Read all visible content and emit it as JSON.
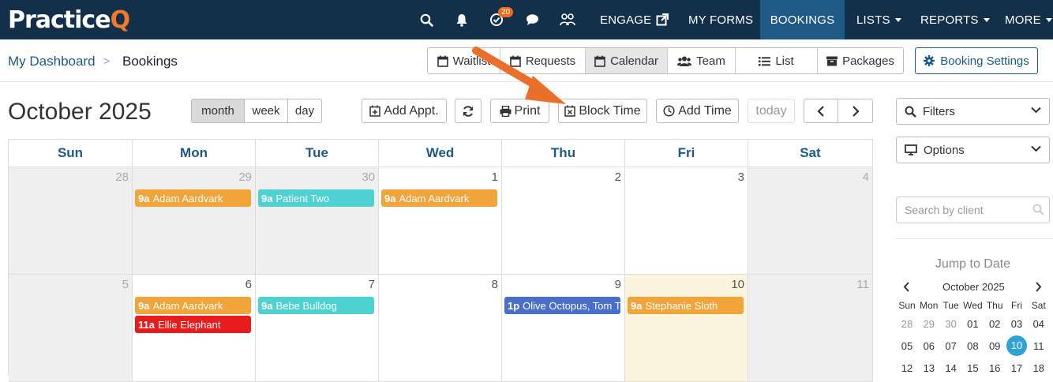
{
  "app": {
    "logo_main": "Practice",
    "logo_accent": "Q"
  },
  "topnav": {
    "notification_count": "20",
    "items": [
      {
        "label": "ENGAGE"
      },
      {
        "label": "MY FORMS"
      },
      {
        "label": "BOOKINGS"
      },
      {
        "label": "LISTS"
      },
      {
        "label": "REPORTS"
      },
      {
        "label": "MORE"
      }
    ],
    "active": "BOOKINGS"
  },
  "breadcrumb": {
    "link": "My Dashboard",
    "separator": ">",
    "current": "Bookings"
  },
  "view_tabs": [
    {
      "label": "Waitlist"
    },
    {
      "label": "Requests"
    },
    {
      "label": "Calendar"
    },
    {
      "label": "Team"
    },
    {
      "label": "List"
    },
    {
      "label": "Packages"
    }
  ],
  "active_view_tab": "Calendar",
  "booking_settings_label": "Booking Settings",
  "calendar": {
    "title": "October 2025",
    "range_buttons": [
      "month",
      "week",
      "day"
    ],
    "active_range": "month",
    "add_appt_label": "Add Appt.",
    "print_label": "Print",
    "block_time_label": "Block Time",
    "add_time_label": "Add Time",
    "today_label": "today",
    "weekdays": [
      "Sun",
      "Mon",
      "Tue",
      "Wed",
      "Thu",
      "Fri",
      "Sat"
    ],
    "weeks": [
      [
        {
          "day": "28",
          "other": true,
          "events": []
        },
        {
          "day": "29",
          "other": true,
          "events": [
            {
              "time": "9a",
              "title": "Adam Aardvark",
              "color": "#f0a43a"
            }
          ]
        },
        {
          "day": "30",
          "other": true,
          "events": [
            {
              "time": "9a",
              "title": "Patient Two",
              "color": "#4fd1d1"
            }
          ]
        },
        {
          "day": "1",
          "events": [
            {
              "time": "9a",
              "title": "Adam Aardvark",
              "color": "#f0a43a"
            }
          ]
        },
        {
          "day": "2",
          "events": []
        },
        {
          "day": "3",
          "events": []
        },
        {
          "day": "4",
          "other": true,
          "events": []
        }
      ],
      [
        {
          "day": "5",
          "other": true,
          "events": []
        },
        {
          "day": "6",
          "events": [
            {
              "time": "9a",
              "title": "Adam Aardvark",
              "color": "#f0a43a"
            },
            {
              "time": "11a",
              "title": "Ellie Elephant",
              "color": "#e81c1c"
            }
          ]
        },
        {
          "day": "7",
          "events": [
            {
              "time": "9a",
              "title": "Bebe Bulldog",
              "color": "#4fd1d1"
            }
          ]
        },
        {
          "day": "8",
          "events": []
        },
        {
          "day": "9",
          "events": [
            {
              "time": "1p",
              "title": "Olive Octopus, Tom T",
              "color": "#4a6fc9"
            }
          ]
        },
        {
          "day": "10",
          "today": true,
          "events": [
            {
              "time": "9a",
              "title": "Stephanie Sloth",
              "color": "#f0a43a"
            }
          ]
        },
        {
          "day": "11",
          "other": true,
          "events": []
        }
      ]
    ]
  },
  "sidebar": {
    "filters_label": "Filters",
    "options_label": "Options",
    "search_placeholder": "Search by client",
    "jump_title": "Jump to Date",
    "mini_month": "October 2025",
    "mini_weekdays": [
      "Sun",
      "Mon",
      "Tue",
      "Wed",
      "Thu",
      "Fri",
      "Sat"
    ],
    "mini_rows": [
      [
        {
          "d": "28",
          "o": true
        },
        {
          "d": "29",
          "o": true
        },
        {
          "d": "30",
          "o": true
        },
        {
          "d": "01"
        },
        {
          "d": "02"
        },
        {
          "d": "03"
        },
        {
          "d": "04"
        }
      ],
      [
        {
          "d": "05"
        },
        {
          "d": "06"
        },
        {
          "d": "07"
        },
        {
          "d": "08"
        },
        {
          "d": "09"
        },
        {
          "d": "10",
          "sel": true
        },
        {
          "d": "11"
        }
      ],
      [
        {
          "d": "12"
        },
        {
          "d": "13"
        },
        {
          "d": "14"
        },
        {
          "d": "15"
        },
        {
          "d": "16"
        },
        {
          "d": "17"
        },
        {
          "d": "18"
        }
      ]
    ]
  },
  "colors": {
    "nav_bg": "#13304a",
    "nav_active": "#1f5a87",
    "brand_orange": "#f07a2a",
    "link_blue": "#1f5a87",
    "today_bg": "#fcf4dd",
    "mini_selected": "#2fa3d6"
  }
}
